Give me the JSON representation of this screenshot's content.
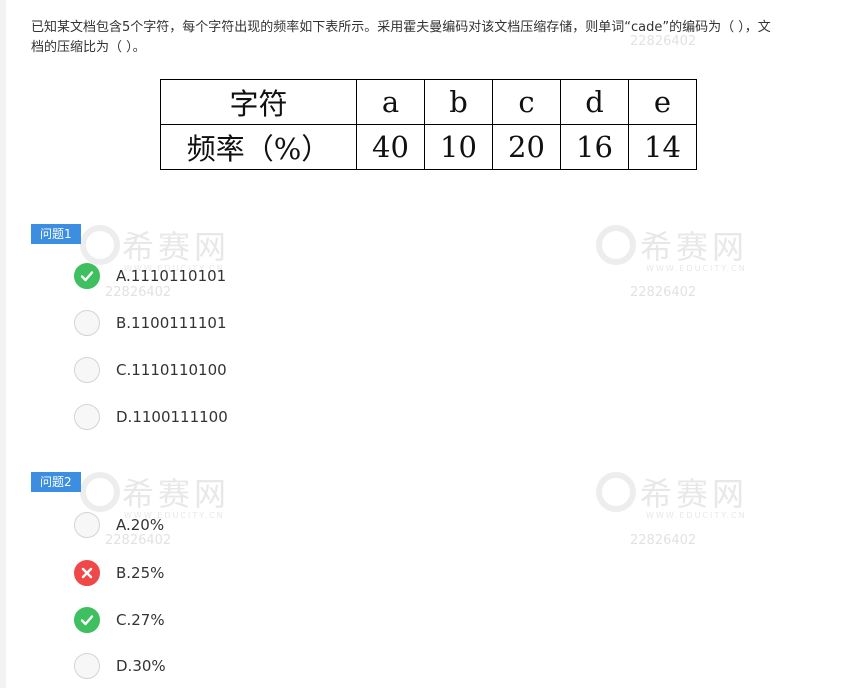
{
  "question": {
    "text_line1": "已知某文档包含5个字符，每个字符出现的频率如下表所示。采用霍夫曼编码对该文档压缩存储，则单词“cade”的编码为（ ），文",
    "text_line2": "档的压缩比为（ ）。"
  },
  "table": {
    "header_label": "字符",
    "freq_label": "频率（%）",
    "chars": [
      "a",
      "b",
      "c",
      "d",
      "e"
    ],
    "freqs": [
      "40",
      "10",
      "20",
      "16",
      "14"
    ]
  },
  "watermark": {
    "brand": "希赛网",
    "site": "WWW.EDUCITY.CN",
    "id": "22826402"
  },
  "questions": [
    {
      "tag": "问题1",
      "options": [
        {
          "label": "A.1110110101",
          "state": "correct"
        },
        {
          "label": "B.1100111101",
          "state": "none"
        },
        {
          "label": "C.1110110100",
          "state": "none"
        },
        {
          "label": "D.1100111100",
          "state": "none"
        }
      ]
    },
    {
      "tag": "问题2",
      "options": [
        {
          "label": "A.20%",
          "state": "none"
        },
        {
          "label": "B.25%",
          "state": "wrong"
        },
        {
          "label": "C.27%",
          "state": "correct"
        },
        {
          "label": "D.30%",
          "state": "none"
        }
      ]
    }
  ],
  "colors": {
    "tag_bg": "#3b8ee0",
    "correct": "#3fc060",
    "wrong": "#f04848"
  }
}
